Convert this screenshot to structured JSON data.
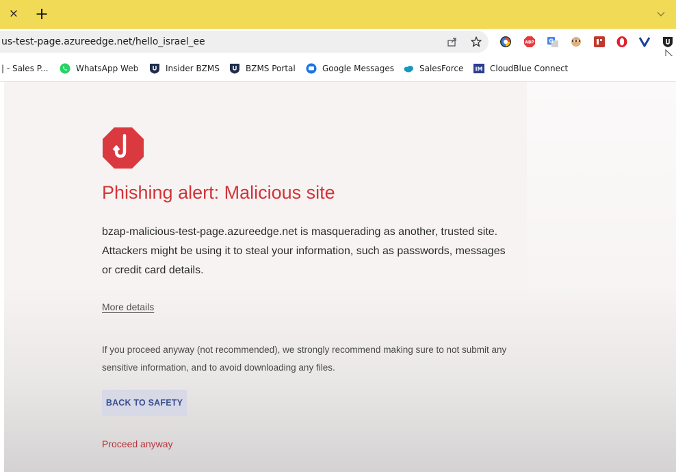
{
  "browser": {
    "tab": {
      "close_glyph": "×",
      "new_tab_glyph": "+"
    },
    "omnibox": {
      "url": "us-test-page.azureedge.net/hello_israel_ee",
      "share_icon": "share-icon",
      "bookmark_star_icon": "star-icon"
    },
    "extensions": [
      "chrome-color-extension-icon",
      "adblock-plus-extension-icon",
      "translate-extension-icon",
      "face-extension-icon",
      "red-square-extension-icon",
      "opera-extension-icon",
      "vee-extension-icon",
      "bzms-shield-extension-icon"
    ],
    "bookmarks": [
      {
        "label": "| - Sales P...",
        "icon": "salesforce-partial-icon"
      },
      {
        "label": "WhatsApp Web",
        "icon": "whatsapp-icon"
      },
      {
        "label": "Insider BZMS",
        "icon": "bzms-shield-icon"
      },
      {
        "label": "BZMS Portal",
        "icon": "bzms-shield-icon"
      },
      {
        "label": "Google Messages",
        "icon": "google-messages-icon"
      },
      {
        "label": "SalesForce",
        "icon": "salesforce-cloud-icon"
      },
      {
        "label": "CloudBlue Connect",
        "icon": "im-icon"
      }
    ],
    "bookmark_badge_text": "IM"
  },
  "page": {
    "logo": "phishing-hook-octagon-icon",
    "title": "Phishing alert: Malicious site",
    "description": "bzap-malicious-test-page.azureedge.net is masquerading as another, trusted site. Attackers might be using it to steal your information, such as passwords, messages or credit card details.",
    "more_details": "More details",
    "warning": "If you proceed anyway (not recommended), we strongly recommend making sure to not submit any sensitive information, and to avoid downloading any files.",
    "back_button": "BACK TO SAFETY",
    "proceed_link": "Proceed anyway"
  },
  "colors": {
    "tab_strip": "#f1da55",
    "alert_red": "#d13438",
    "button_bg": "#d7d9e6",
    "button_text": "#3b4f92",
    "proceed_text": "#b7343b"
  }
}
